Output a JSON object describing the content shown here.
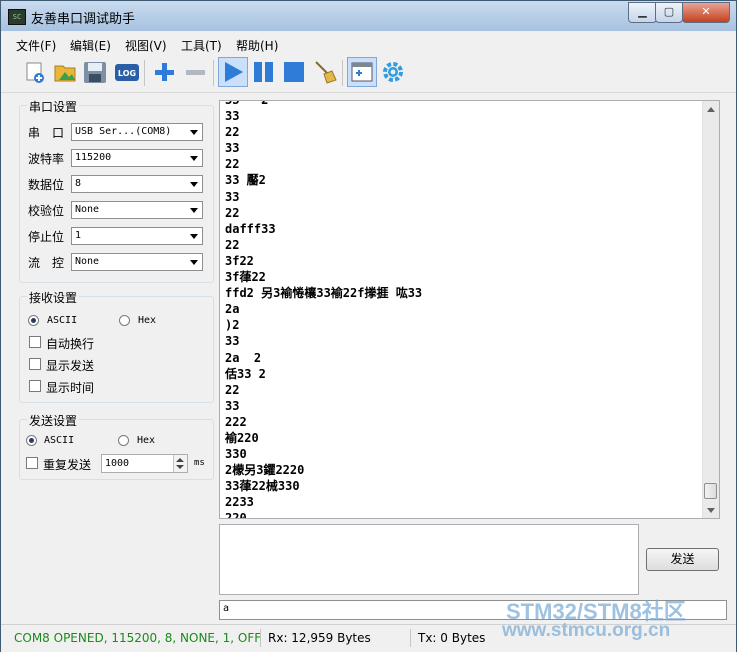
{
  "window": {
    "title": "友善串口调试助手",
    "icon_name": "serial-app-icon",
    "min_label": "▁",
    "max_label": "▢",
    "close_label": "✕"
  },
  "menu": [
    {
      "label": "文件(F)"
    },
    {
      "label": "编辑(E)"
    },
    {
      "label": "视图(V)"
    },
    {
      "label": "工具(T)"
    },
    {
      "label": "帮助(H)"
    }
  ],
  "toolbar": {
    "icons": [
      "new-file-icon",
      "open-folder-icon",
      "save-disk-icon",
      "log-icon",
      "add-plus-icon",
      "remove-minus-icon",
      "play-icon",
      "pause-icon",
      "stop-icon",
      "clear-broom-icon",
      "new-window-icon",
      "settings-gear-icon"
    ],
    "log_label": "LOG"
  },
  "serial_settings": {
    "title": "串口设置",
    "port": {
      "label": "串　口",
      "value": "USB Ser...(COM8)"
    },
    "baud": {
      "label": "波特率",
      "value": "115200"
    },
    "databits": {
      "label": "数据位",
      "value": "8"
    },
    "parity": {
      "label": "校验位",
      "value": "None"
    },
    "stopbits": {
      "label": "停止位",
      "value": "1"
    },
    "flow": {
      "label": "流　控",
      "value": "None"
    }
  },
  "receive_settings": {
    "title": "接收设置",
    "ascii_label": "ASCII",
    "hex_label": "Hex",
    "mode_selected": "ASCII",
    "auto_wrap_label": "自动换行",
    "show_send_label": "显示发送",
    "show_time_label": "显示时间"
  },
  "send_settings": {
    "title": "发送设置",
    "ascii_label": "ASCII",
    "hex_label": "Hex",
    "mode_selected": "ASCII",
    "repeat_label": "重复发送",
    "interval_value": "1000",
    "interval_unit": "ms"
  },
  "receive_text": "33   2\n33\n22\n33\n22\n33 靨2\n33\n22\ndafff33\n22\n3f22\n3f葎22\nffd2 另3褕惓欀33褕22f搼捱 吰33\n2a\n)2\n33\n2a  2\n佸33 2\n22\n33\n222\n褕220\n330\n2檬另3鑺2220\n33葎22械330\n2233\n220",
  "send_text": "",
  "send_button": "发送",
  "bottom_combo_value": "a",
  "status": {
    "connection": "COM8 OPENED, 115200, 8, NONE, 1, OFF",
    "rx": "Rx: 12,959 Bytes",
    "tx": "Tx: 0 Bytes",
    "connection_color": "#1a8a1a"
  },
  "watermark": {
    "line1": "STM32/STM8社区",
    "line2": "www.stmcu.org.cn"
  },
  "colors": {
    "accent_blue": "#2f7bd8",
    "title_bar": "#b9cfe8"
  }
}
